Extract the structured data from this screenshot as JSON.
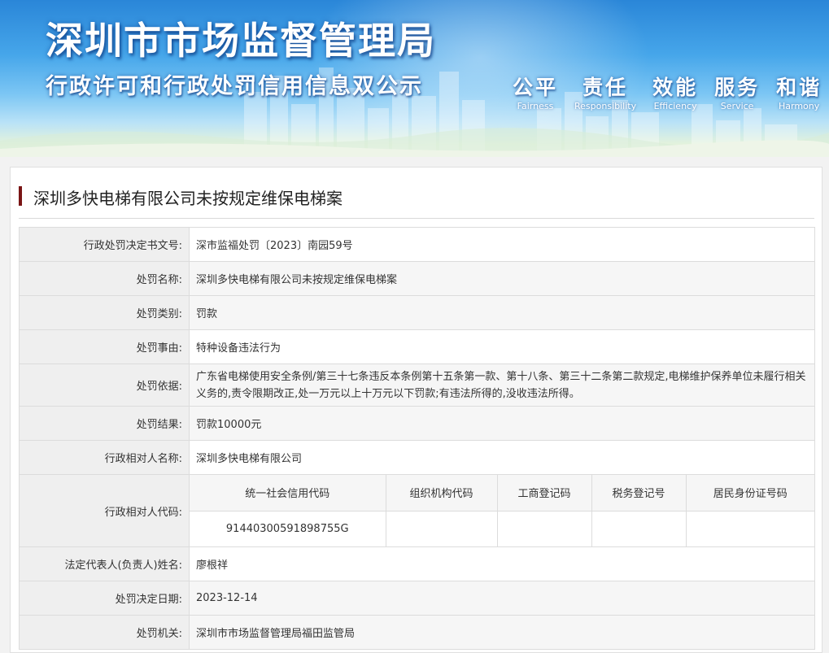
{
  "banner": {
    "title": "深圳市市场监督管理局",
    "subtitle": "行政许可和行政处罚信用信息双公示",
    "values": [
      {
        "zh": "公平",
        "en": "Fairness"
      },
      {
        "zh": "责任",
        "en": "Responsibility"
      },
      {
        "zh": "效能",
        "en": "Efficiency"
      },
      {
        "zh": "服务",
        "en": "Service"
      },
      {
        "zh": "和谐",
        "en": "Harmony"
      }
    ]
  },
  "case": {
    "title": "深圳多快电梯有限公司未按规定维保电梯案"
  },
  "rows": {
    "doc_no": {
      "label": "行政处罚决定书文号:",
      "value": "深市监福处罚〔2023〕南园59号"
    },
    "name": {
      "label": "处罚名称:",
      "value": "深圳多快电梯有限公司未按规定维保电梯案"
    },
    "category": {
      "label": "处罚类别:",
      "value": "罚款"
    },
    "cause": {
      "label": "处罚事由:",
      "value": "特种设备违法行为"
    },
    "basis": {
      "label": "处罚依据:",
      "value": "广东省电梯使用安全条例/第三十七条违反本条例第十五条第一款、第十八条、第三十二条第二款规定,电梯维护保养单位未履行相关义务的,责令限期改正,处一万元以上十万元以下罚款;有违法所得的,没收违法所得。"
    },
    "result": {
      "label": "处罚结果:",
      "value": "罚款10000元"
    },
    "party_name": {
      "label": "行政相对人名称:",
      "value": "深圳多快电梯有限公司"
    },
    "party_code": {
      "label": "行政相对人代码:",
      "headers": [
        "统一社会信用代码",
        "组织机构代码",
        "工商登记码",
        "税务登记号",
        "居民身份证号码"
      ],
      "values": [
        "91440300591898755G",
        "",
        "",
        "",
        ""
      ]
    },
    "legal_rep": {
      "label": "法定代表人(负责人)姓名:",
      "value": "廖根祥"
    },
    "decision_date": {
      "label": "处罚决定日期:",
      "value": "2023-12-14"
    },
    "authority": {
      "label": "处罚机关:",
      "value": "深圳市市场监督管理局福田监管局"
    }
  }
}
